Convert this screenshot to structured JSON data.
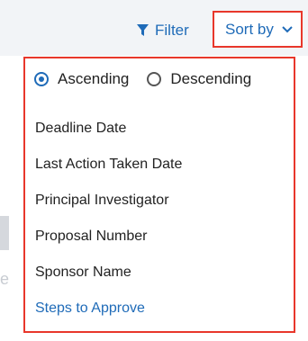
{
  "toolbar": {
    "filter_label": "Filter",
    "filter_icon": "funnel-icon",
    "sort_label": "Sort by",
    "sort_icon": "chevron-down-icon"
  },
  "sort_menu": {
    "order": {
      "ascending_label": "Ascending",
      "descending_label": "Descending",
      "selected": "Ascending"
    },
    "options": [
      {
        "label": "Deadline Date"
      },
      {
        "label": "Last Action Taken Date"
      },
      {
        "label": "Principal Investigator"
      },
      {
        "label": "Proposal Number"
      },
      {
        "label": "Sponsor Name"
      },
      {
        "label": "Steps to Approve"
      }
    ],
    "active_option": "Steps to Approve"
  },
  "colors": {
    "accent": "#1f6bb8",
    "highlight_border": "#e8372b",
    "text": "#222222"
  }
}
